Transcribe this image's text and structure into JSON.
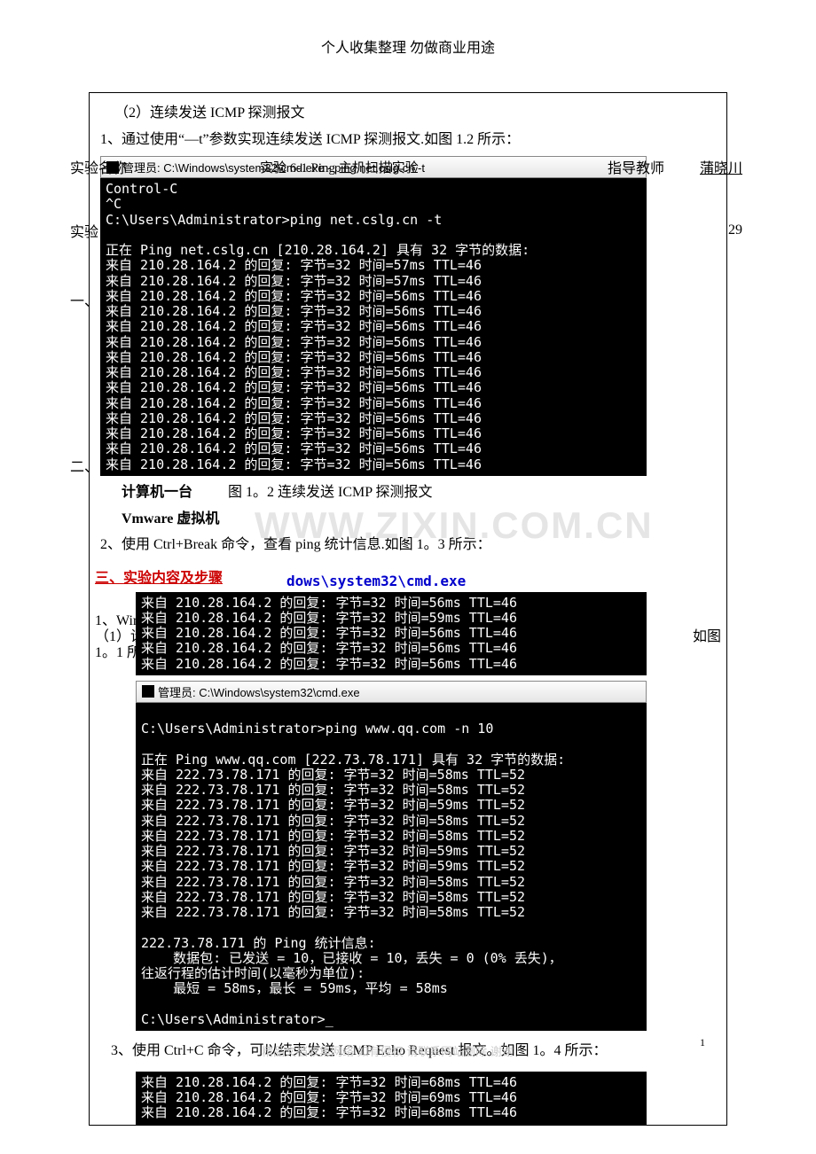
{
  "header": "个人收集整理  勿做商业用途",
  "section2_title": "（2）连续发送 ICMP 探测报文",
  "section2_line1": "1、通过使用“—t”参数实现连续发送 ICMP 探测报文.如图 1.2 所示：",
  "overlay1_left": "实验名称",
  "overlay1_mid": "实验 6-1   Ping 主机扫描实验",
  "overlay1_r1": "指导教师",
  "overlay1_r2": "蒲晓川",
  "overlay2_left": "实验",
  "overlay2_right": "29",
  "overlay3": "一、",
  "overlay4": "二、",
  "term1_titlebar": "管理员: C:\\Windows\\system32\\cmd.exe - ping  net.cslg.cn  -t",
  "term1": [
    "Control-C",
    "^C",
    "C:\\Users\\Administrator>ping net.cslg.cn -t",
    "",
    "正在 Ping net.cslg.cn [210.28.164.2] 具有 32 字节的数据:",
    "来自 210.28.164.2 的回复: 字节=32 时间=57ms TTL=46",
    "来自 210.28.164.2 的回复: 字节=32 时间=57ms TTL=46",
    "来自 210.28.164.2 的回复: 字节=32 时间=56ms TTL=46",
    "来自 210.28.164.2 的回复: 字节=32 时间=56ms TTL=46",
    "来自 210.28.164.2 的回复: 字节=32 时间=56ms TTL=46",
    "来自 210.28.164.2 的回复: 字节=32 时间=56ms TTL=46",
    "来自 210.28.164.2 的回复: 字节=32 时间=56ms TTL=46",
    "来自 210.28.164.2 的回复: 字节=32 时间=56ms TTL=46",
    "来自 210.28.164.2 的回复: 字节=32 时间=56ms TTL=46",
    "来自 210.28.164.2 的回复: 字节=32 时间=56ms TTL=46",
    "来自 210.28.164.2 的回复: 字节=32 时间=56ms TTL=46",
    "来自 210.28.164.2 的回复: 字节=32 时间=56ms TTL=46",
    "来自 210.28.164.2 的回复: 字节=32 时间=56ms TTL=46",
    "来自 210.28.164.2 的回复: 字节=32 时间=56ms TTL=46"
  ],
  "fig12_prefix": "计算机一台",
  "fig12_caption": "图 1。2 连续发送 ICMP 探测报文",
  "vmware_line": "Vmware 虚拟机",
  "section2_line2": " 2、使用 Ctrl+Break 命令，查看 ping 统计信息.如图 1。3 所示：",
  "heading3": "三、实验内容及步骤",
  "heading3_overlay": "dows\\system32\\cmd.exe",
  "win_line": "1、Win",
  "set_line": "（1）设",
  "one1_line": "1。1 所",
  "right_ruotu": "如图",
  "term2a": [
    "来自 210.28.164.2 的回复: 字节=32 时间=56ms TTL=46",
    "来自 210.28.164.2 的回复: 字节=32 时间=59ms TTL=46",
    "来自 210.28.164.2 的回复: 字节=32 时间=56ms TTL=46",
    "来自 210.28.164.2 的回复: 字节=32 时间=56ms TTL=46",
    "来自 210.28.164.2 的回复: 字节=32 时间=56ms TTL=46"
  ],
  "term2_titlebar": "管理员: C:\\Windows\\system32\\cmd.exe",
  "term2": [
    "",
    "C:\\Users\\Administrator>ping www.qq.com -n 10",
    "",
    "正在 Ping www.qq.com [222.73.78.171] 具有 32 字节的数据:",
    "来自 222.73.78.171 的回复: 字节=32 时间=58ms TTL=52",
    "来自 222.73.78.171 的回复: 字节=32 时间=58ms TTL=52",
    "来自 222.73.78.171 的回复: 字节=32 时间=59ms TTL=52",
    "来自 222.73.78.171 的回复: 字节=32 时间=58ms TTL=52",
    "来自 222.73.78.171 的回复: 字节=32 时间=58ms TTL=52",
    "来自 222.73.78.171 的回复: 字节=32 时间=59ms TTL=52",
    "来自 222.73.78.171 的回复: 字节=32 时间=59ms TTL=52",
    "来自 222.73.78.171 的回复: 字节=32 时间=58ms TTL=52",
    "来自 222.73.78.171 的回复: 字节=32 时间=58ms TTL=52",
    "来自 222.73.78.171 的回复: 字节=32 时间=58ms TTL=52",
    "",
    "222.73.78.171 的 Ping 统计信息:",
    "    数据包: 已发送 = 10，已接收 = 10，丢失 = 0 (0% 丢失)，",
    "往返行程的估计时间(以毫秒为单位):",
    "    最短 = 58ms，最长 = 59ms，平均 = 58ms",
    "",
    "C:\\Users\\Administrator>_"
  ],
  "section2_line3": "3、使用 Ctrl+C 命令，可以结束发送 ICMP Echo Request 报文。如图 1。4 所示：",
  "term3": [
    "来自 210.28.164.2 的回复: 字节=32 时间=68ms TTL=46",
    "来自 210.28.164.2 的回复: 字节=32 时间=69ms TTL=46",
    "来自 210.28.164.2 的回复: 字节=32 时间=68ms TTL=46"
  ],
  "watermark1": "WWW.ZIXIN.COM.CN",
  "watermark2": "精品文档收集网络 如有侵权 请联系网站删除 谢谢",
  "page_no": "1"
}
